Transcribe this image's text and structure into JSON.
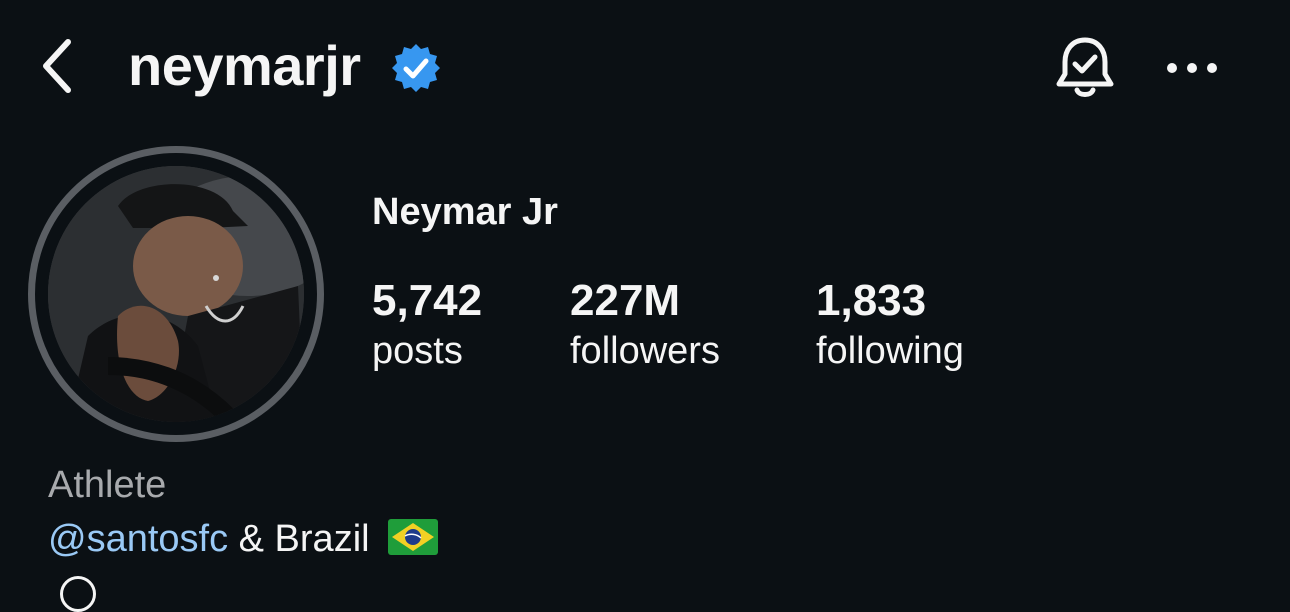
{
  "header": {
    "username": "neymarjr",
    "verified_icon": "verified-badge-icon",
    "back_icon": "chevron-left-icon",
    "bell_icon": "bell-check-icon",
    "more_icon": "more-horizontal-icon"
  },
  "profile": {
    "display_name": "Neymar Jr",
    "stats": [
      {
        "value": "5,742",
        "label": "posts"
      },
      {
        "value": "227M",
        "label": "followers"
      },
      {
        "value": "1,833",
        "label": "following"
      }
    ],
    "category": "Athlete",
    "bio": {
      "mention": "@santosfc",
      "text": " & Brazil"
    }
  },
  "colors": {
    "background": "#0b1014",
    "text": "#f5f5f5",
    "muted": "#a8aaad",
    "link": "#9ac9f5",
    "verified": "#3797f0",
    "ring": "#5a5e63"
  }
}
